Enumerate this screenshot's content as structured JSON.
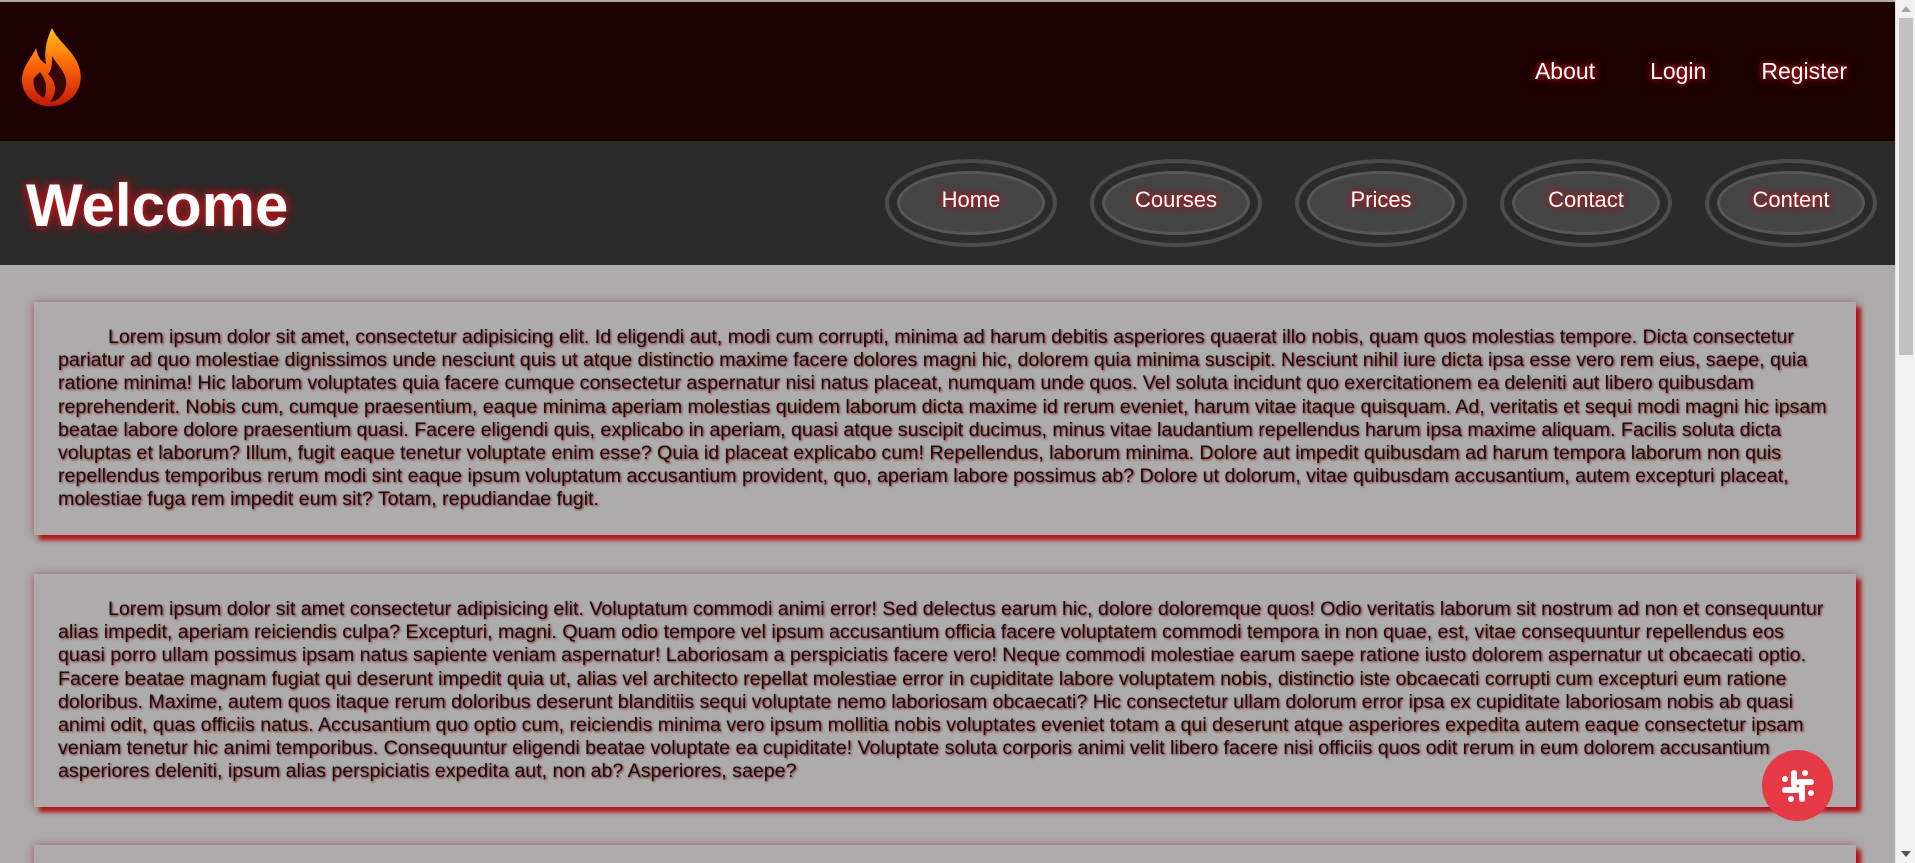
{
  "header": {
    "logo_icon": "flame-icon",
    "links": [
      {
        "label": "About"
      },
      {
        "label": "Login"
      },
      {
        "label": "Register"
      }
    ]
  },
  "navbar": {
    "title": "Welcome",
    "buttons": [
      {
        "label": "Home"
      },
      {
        "label": "Courses"
      },
      {
        "label": "Prices"
      },
      {
        "label": "Contact"
      },
      {
        "label": "Content"
      }
    ]
  },
  "content": {
    "paragraphs": [
      "Lorem ipsum dolor sit amet, consectetur adipisicing elit. Id eligendi aut, modi cum corrupti, minima ad harum debitis asperiores quaerat illo nobis, quam quos molestias tempore. Dicta consectetur pariatur ad quo molestiae dignissimos unde nesciunt quis ut atque distinctio maxime facere dolores magni hic, dolorem quia minima suscipit. Nesciunt nihil iure dicta ipsa esse vero rem eius, saepe, quia ratione minima! Hic laborum voluptates quia facere cumque consectetur aspernatur nisi natus placeat, numquam unde quos. Vel soluta incidunt quo exercitationem ea deleniti aut libero quibusdam reprehenderit. Nobis cum, cumque praesentium, eaque minima aperiam molestias quidem laborum dicta maxime id rerum eveniet, harum vitae itaque quisquam. Ad, veritatis et sequi modi magni hic ipsam beatae labore dolore praesentium quasi. Facere eligendi quis, explicabo in aperiam, quasi atque suscipit ducimus, minus vitae laudantium repellendus harum ipsa maxime aliquam. Facilis soluta dicta voluptas et laborum? Illum, fugit eaque tenetur voluptate enim esse? Quia id placeat explicabo cum! Repellendus, laborum minima. Dolore aut impedit quibusdam ad harum tempora laborum non quis repellendus temporibus rerum modi sint eaque ipsum voluptatum accusantium provident, quo, aperiam labore possimus ab? Dolore ut dolorum, vitae quibusdam accusantium, autem excepturi placeat, molestiae fuga rem impedit eum sit? Totam, repudiandae fugit.",
      "Lorem ipsum dolor sit amet consectetur adipisicing elit. Voluptatum commodi animi error! Sed delectus earum hic, dolore doloremque quos! Odio veritatis laborum sit nostrum ad non et consequuntur alias impedit, aperiam reiciendis culpa? Excepturi, magni. Quam odio tempore vel ipsum accusantium officia facere voluptatem commodi tempora in non quae, est, vitae consequuntur repellendus eos quasi porro ullam possimus ipsam natus sapiente veniam aspernatur! Laboriosam a perspiciatis facere vero! Neque commodi molestiae earum saepe ratione iusto dolorem aspernatur ut obcaecati optio. Facere beatae magnam fugiat qui deserunt impedit quia ut, alias vel architecto repellat molestiae error in cupiditate labore voluptatem nobis, distinctio iste obcaecati corrupti cum excepturi eum ratione doloribus. Maxime, autem quos itaque rerum doloribus deserunt blanditiis sequi voluptate nemo laboriosam obcaecati? Hic consectetur ullam dolorum error ipsa ex cupiditate laboriosam nobis ab quasi animi odit, quas officiis natus. Accusantium quo optio cum, reiciendis minima vero ipsum mollitia nobis voluptates eveniet totam a qui deserunt atque asperiores expedita autem eaque consectetur ipsam veniam tenetur hic animi temporibus. Consequuntur eligendi beatae voluptate ea cupiditate! Voluptate soluta corporis animi velit libero facere nisi officiis quos odit rerum in eum dolorem accusantium asperiores deleniti, ipsum alias perspiciatis expedita aut, non ab? Asperiores, saepe?"
    ]
  },
  "floating_button": {
    "icon": "slack-icon",
    "color": "#e53a45"
  },
  "colors": {
    "topbar": "#1d0103",
    "navbar": "#2b2b2b",
    "page_bg": "#acaaab",
    "glow": "#d1151c"
  }
}
